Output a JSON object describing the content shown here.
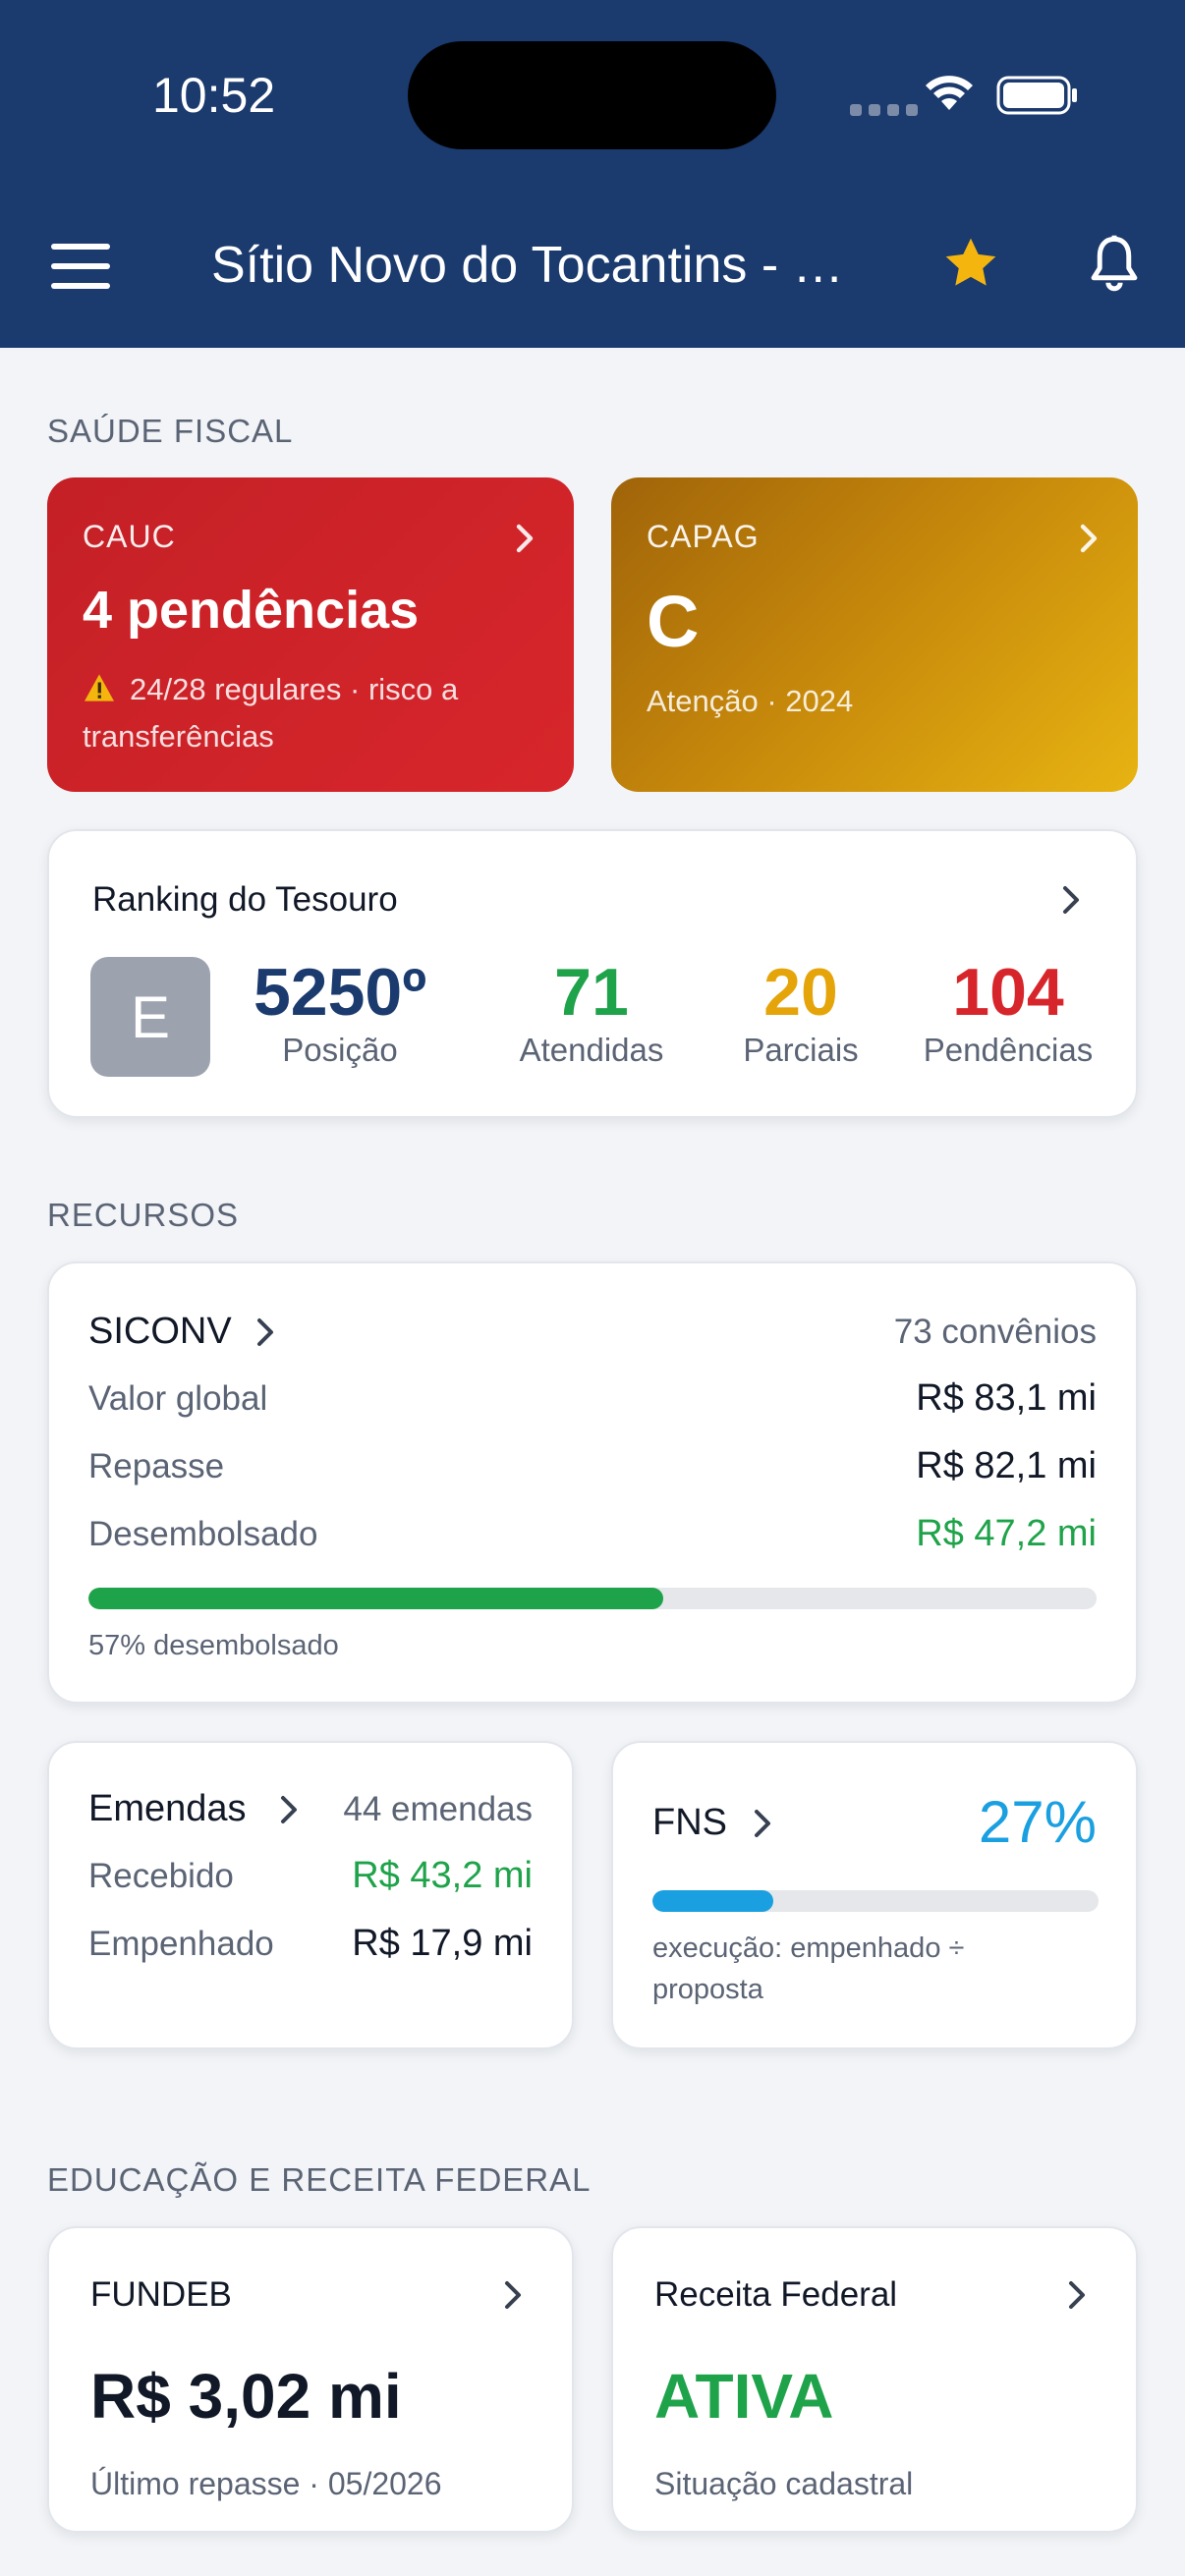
{
  "status_bar": {
    "time": "10:52"
  },
  "header": {
    "title": "Sítio Novo do Tocantins - MA",
    "star_color": "#F5B50F"
  },
  "saude_fiscal": {
    "section_label": "SAÚDE FISCAL",
    "cauc": {
      "label": "CAUC",
      "value": "4 pendências",
      "note": "24/28 regulares · risco a transferências",
      "color": "#D7262B"
    },
    "capag": {
      "label": "CAPAG",
      "value": "C",
      "note": "Atenção · 2024",
      "color": "#C88A0B"
    }
  },
  "ranking": {
    "title": "Ranking do Tesouro",
    "badge": "E",
    "posicao": {
      "value": "5250º",
      "label": "Posição",
      "color": "#1B3A6E"
    },
    "atendidas": {
      "value": "71",
      "label": "Atendidas",
      "color": "#1FA34A"
    },
    "parciais": {
      "value": "20",
      "label": "Parciais",
      "color": "#E5A50A"
    },
    "pendencias": {
      "value": "104",
      "label": "Pendências",
      "color": "#D7262B"
    }
  },
  "recursos": {
    "section_label": "RECURSOS",
    "siconv": {
      "title": "SICONV",
      "count": "73 convênios",
      "rows": [
        {
          "label": "Valor global",
          "value": "R$  83,1 mi"
        },
        {
          "label": "Repasse",
          "value": "R$  82,1 mi"
        },
        {
          "label": "Desembolsado",
          "value": "R$  47,2 mi"
        }
      ],
      "progress": 0.57,
      "progress_note": "57% desembolsado",
      "progress_color": "#1FA34A"
    },
    "emendas": {
      "title": "Emendas",
      "count": "44 emendas",
      "rows": [
        {
          "label": "Recebido",
          "value": "R$  43,2 mi"
        },
        {
          "label": "Empenhado",
          "value": "R$  17,9 mi"
        }
      ]
    },
    "fns": {
      "title": "FNS",
      "value": "27%",
      "progress": 0.27,
      "note": "execução: empenhado ÷ proposta",
      "color": "#1A9FE0"
    }
  },
  "educacao": {
    "section_label": "EDUCAÇÃO E RECEITA FEDERAL",
    "fundeb": {
      "title": "FUNDEB",
      "value": "R$  3,02 mi",
      "note": "Último repasse · 05/2026"
    },
    "receita": {
      "title": "Receita Federal",
      "value": "ATIVA",
      "note": "Situação cadastral",
      "color": "#1FA34A"
    }
  }
}
